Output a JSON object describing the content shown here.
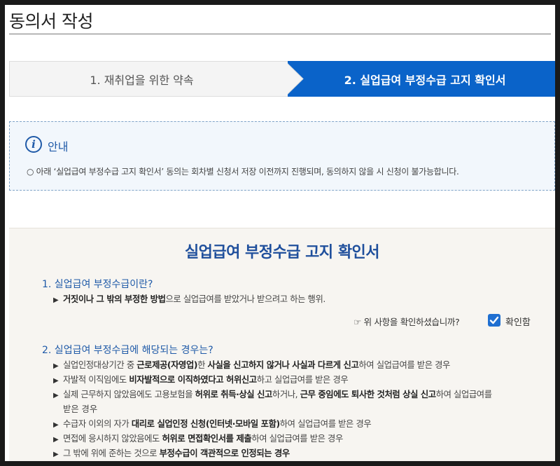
{
  "page": {
    "title": "동의서 작성"
  },
  "steps": [
    {
      "label": "1. 재취업을 위한 약속",
      "active": false
    },
    {
      "label": "2. 실업급여 부정수급 고지 확인서",
      "active": true
    }
  ],
  "colors": {
    "accent": "#0a63c9",
    "heading": "#1f4f9c",
    "notice_bg": "#f2f7fc"
  },
  "notice": {
    "icon": "info-icon",
    "title": "안내",
    "text": "○ 아래 ‘실업급여 부정수급 고지 확인서’ 동의는 회차별 신청서 저장 이전까지 진행되며, 동의하지 않을 시 신청이 불가능합니다."
  },
  "document": {
    "title": "실업급여 부정수급 고지 확인서",
    "section1": {
      "heading": "1. 실업급여 부정수급이란?",
      "bullet_bold": "거짓이나 그 밖의 부정한 방법",
      "bullet_rest": "으로 실업급여를 받았거나 받으려고 하는 행위."
    },
    "confirm": {
      "question": "☞ 위 사항을 확인하셨습니까?",
      "checkbox_label": "확인함",
      "checked": true
    },
    "section2": {
      "heading": "2. 실업급여 부정수급에 해당되는 경우는?",
      "b1_a": "실업인정대상기간 중 ",
      "b1_b": "근로제공(자영업)",
      "b1_c": "한 ",
      "b1_d": "사실을 신고하지 않거나 사실과 다르게 신고",
      "b1_e": "하여 실업급여를 받은 경우",
      "b2_a": "자발적 이직임에도 ",
      "b2_b": "비자발적으로 이직하였다고 허위신고",
      "b2_c": "하고 실업급여를 받은 경우",
      "b3_a": "실제 근무하지 않았음에도 고용보험을 ",
      "b3_b": "허위로 취득·상실 신고",
      "b3_c": "하거나, ",
      "b3_d": "근무 중임에도 퇴사한 것처럼 상실 신고",
      "b3_e": "하여 실업급여를",
      "b3_cont": "받은 경우",
      "b4_a": "수급자 이외의 자가 ",
      "b4_b": "대리로 실업인정 신청(인터넷·모바일 포함)",
      "b4_c": "하여 실업급여를 받은 경우",
      "b5_a": "면접에 응시하지 않았음에도 ",
      "b5_b": "허위로 면접확인서를 제출",
      "b5_c": "하여 실업급여를 받은 경우",
      "b6_a": "그 밖에 위에 준하는 것으로 ",
      "b6_b": "부정수급이 객관적으로 인정되는 경우"
    }
  }
}
